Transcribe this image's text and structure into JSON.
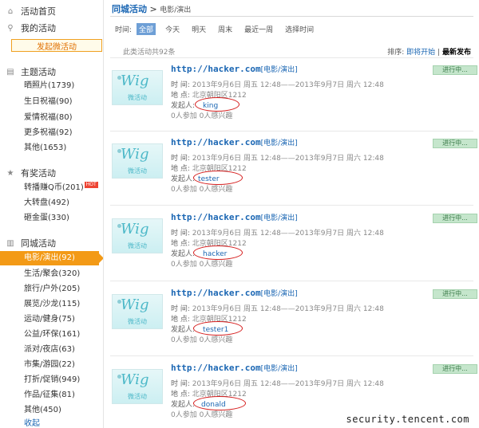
{
  "sidebar": {
    "home": "活动首页",
    "mine": "我的活动",
    "compose": "发起微活动",
    "theme_head": "主题活动",
    "theme_items": [
      "晒照片(1739)",
      "生日祝福(90)",
      "爱情祝福(80)",
      "更多祝福(92)",
      "其他(1653)"
    ],
    "prize_head": "有奖活动",
    "prize_items": [
      "转播赚Q币(201)",
      "大转盘(492)",
      "砸金蛋(330)"
    ],
    "hot_badge": "HOT",
    "city_head": "同城活动",
    "city_active": "电影/演出(92)",
    "city_items": [
      "生活/聚会(320)",
      "旅行/户外(205)",
      "展览/沙龙(115)",
      "运动/健身(75)",
      "公益/环保(161)",
      "派对/夜店(63)",
      "市集/游园(22)",
      "打折/促销(949)",
      "作品/征集(81)",
      "其他(450)",
      "收起"
    ]
  },
  "main": {
    "crumb_main": "同城活动",
    "crumb_sep": ">",
    "crumb_sub": "电影/演出",
    "filter_label": "时间:",
    "filter_options": [
      "全部",
      "今天",
      "明天",
      "周末",
      "最近一周",
      "选择时间"
    ],
    "summary": "此类活动共92条",
    "sort_label": "排序:",
    "sort_upcoming": "即将开始",
    "sort_sep": "|",
    "sort_latest": "最新发布"
  },
  "card_common": {
    "url": "http://hacker.com",
    "category": "[电影/演出]",
    "time_label": "时    间:",
    "time_value": "2013年9月6日 周五 12:48——2013年9月7日 周六 12:48",
    "place_label": "地    点:",
    "place_value": "北京朝阳区1212",
    "org_label": "发起人:",
    "stats": "0人参加  0人感兴趣",
    "status": "进行中...",
    "thumb_logo": "Wig",
    "thumb_caption": "微活动"
  },
  "cards": [
    {
      "organizer": "king"
    },
    {
      "organizer": "tester"
    },
    {
      "organizer": "hacker"
    },
    {
      "organizer": "tester1"
    },
    {
      "organizer": "donald"
    }
  ],
  "watermark": "security.tencent.com"
}
